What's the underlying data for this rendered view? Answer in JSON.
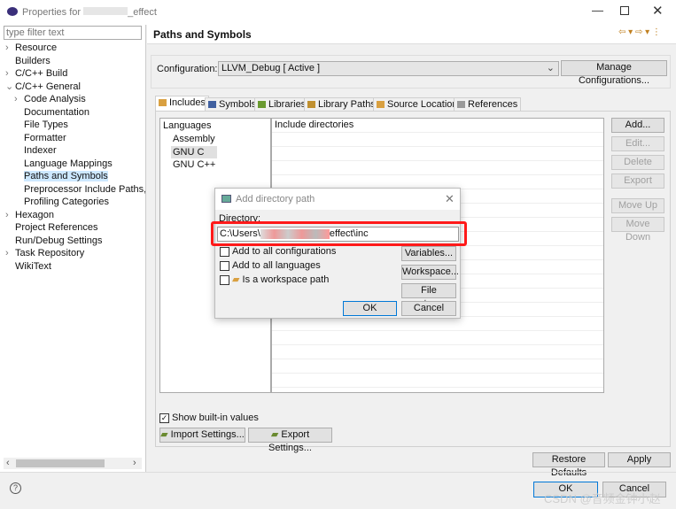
{
  "window": {
    "title": "Properties for ",
    "title_suffix": "_effect",
    "controls": [
      "minimize",
      "maximize",
      "close"
    ]
  },
  "filter": {
    "placeholder": "type filter text"
  },
  "tree": [
    {
      "label": "Resource",
      "indent": 0,
      "arrow": "›"
    },
    {
      "label": "Builders",
      "indent": 0,
      "arrow": ""
    },
    {
      "label": "C/C++ Build",
      "indent": 0,
      "arrow": "›"
    },
    {
      "label": "C/C++ General",
      "indent": 0,
      "arrow": "⌄"
    },
    {
      "label": "Code Analysis",
      "indent": 1,
      "arrow": "›"
    },
    {
      "label": "Documentation",
      "indent": 1,
      "arrow": ""
    },
    {
      "label": "File Types",
      "indent": 1,
      "arrow": ""
    },
    {
      "label": "Formatter",
      "indent": 1,
      "arrow": ""
    },
    {
      "label": "Indexer",
      "indent": 1,
      "arrow": ""
    },
    {
      "label": "Language Mappings",
      "indent": 1,
      "arrow": ""
    },
    {
      "label": "Paths and Symbols",
      "indent": 1,
      "arrow": "",
      "selected": true
    },
    {
      "label": "Preprocessor Include Paths, M",
      "indent": 1,
      "arrow": ""
    },
    {
      "label": "Profiling Categories",
      "indent": 1,
      "arrow": ""
    },
    {
      "label": "Hexagon",
      "indent": 0,
      "arrow": "›"
    },
    {
      "label": "Project References",
      "indent": 0,
      "arrow": ""
    },
    {
      "label": "Run/Debug Settings",
      "indent": 0,
      "arrow": ""
    },
    {
      "label": "Task Repository",
      "indent": 0,
      "arrow": "›"
    },
    {
      "label": "WikiText",
      "indent": 0,
      "arrow": ""
    }
  ],
  "page": {
    "title": "Paths and Symbols",
    "nav": "⇦ ▾ ⇨ ▾ ⋮"
  },
  "config": {
    "label": "Configuration:",
    "value": "LLVM_Debug  [ Active ]",
    "manage": "Manage Configurations..."
  },
  "tabs": [
    {
      "label": "Includes",
      "icon": "includes-icon",
      "color": "#d9a040",
      "selected": true
    },
    {
      "label": "Symbols",
      "icon": "hash-icon",
      "color": "#4060a0"
    },
    {
      "label": "Libraries",
      "icon": "library-icon",
      "color": "#6a9a30"
    },
    {
      "label": "Library Paths",
      "icon": "folder-icon",
      "color": "#c09030"
    },
    {
      "label": "Source Location",
      "icon": "source-folder-icon",
      "color": "#d9a040"
    },
    {
      "label": "References",
      "icon": "references-icon",
      "color": "#999999"
    }
  ],
  "languages": {
    "header": "Languages",
    "items": [
      "Assembly",
      "GNU C",
      "GNU C++"
    ],
    "selected": "GNU C"
  },
  "directories": {
    "header": "Include directories"
  },
  "side_buttons": [
    {
      "label": "Add...",
      "enabled": true
    },
    {
      "label": "Edit...",
      "enabled": false
    },
    {
      "label": "Delete",
      "enabled": false
    },
    {
      "label": "Export",
      "enabled": false
    },
    {
      "label": "Move Up",
      "enabled": false
    },
    {
      "label": "Move Down",
      "enabled": false
    }
  ],
  "show_builtin": {
    "label": "Show built-in values",
    "checked": true
  },
  "import_label": "Import Settings...",
  "export_label": "Export Settings...",
  "restore_label": "Restore Defaults",
  "apply_label": "Apply",
  "ok_label": "OK",
  "cancel_label": "Cancel",
  "watermark": "CSDN @音频金钟小赵",
  "dialog": {
    "title": "Add directory path",
    "dir_label": "Directory:",
    "path_prefix": "C:\\Users\\",
    "path_suffix": "effect\\inc",
    "checks": [
      {
        "label": "Add to all configurations",
        "checked": false
      },
      {
        "label": "Add to all languages",
        "checked": false
      },
      {
        "label": "Is a workspace path",
        "checked": false
      }
    ],
    "variables": "Variables...",
    "workspace": "Workspace...",
    "filesystem": "File system...",
    "ok": "OK",
    "cancel": "Cancel",
    "highlight_color": "#ff1a1a"
  }
}
